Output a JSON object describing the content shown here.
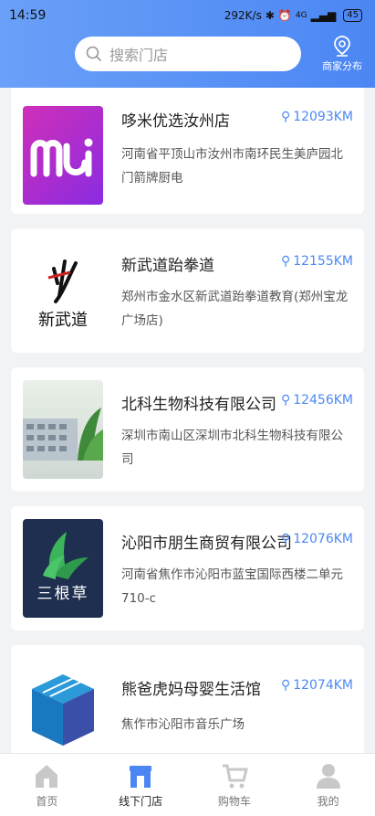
{
  "status_bar": {
    "time": "14:59",
    "network_speed": "292K/s",
    "signal": "4G",
    "battery": "45"
  },
  "search": {
    "placeholder": "搜索门店"
  },
  "merchant_map": {
    "label": "商家分布"
  },
  "stores": [
    {
      "name": "哆米优选汝州店",
      "distance": "12093KM",
      "address": "河南省平顶山市汝州市南环民生美庐园北门箭牌厨电",
      "logo": "mi-logo"
    },
    {
      "name": "新武道跆拳道",
      "distance": "12155KM",
      "address": "郑州市金水区新武道跆拳道教育(郑州宝龙广场店)",
      "logo": "xinwudao-calligraphy-logo"
    },
    {
      "name": "北科生物科技有限公司",
      "distance": "12456KM",
      "address": "深圳市南山区深圳市北科生物科技有限公司",
      "logo": "building-photo"
    },
    {
      "name": "沁阳市朋生商贸有限公司",
      "distance": "12076KM",
      "address": "河南省焦作市沁阳市蓝宝国际西楼二单元710-c",
      "logo": "sangencao-logo",
      "logo_text": "三根草"
    },
    {
      "name": "熊爸虎妈母婴生活馆",
      "distance": "12074KM",
      "address": "焦作市沁阳市音乐广场",
      "logo": "book-cube-logo"
    }
  ],
  "tabbar": [
    {
      "label": "首页",
      "icon": "home-icon"
    },
    {
      "label": "线下门店",
      "icon": "store-icon",
      "active": true
    },
    {
      "label": "购物车",
      "icon": "cart-icon"
    },
    {
      "label": "我的",
      "icon": "user-icon"
    }
  ],
  "colors": {
    "header_gradient_start": "#6aa0f8",
    "header_gradient_end": "#4b86f3",
    "accent": "#4a8af4"
  }
}
